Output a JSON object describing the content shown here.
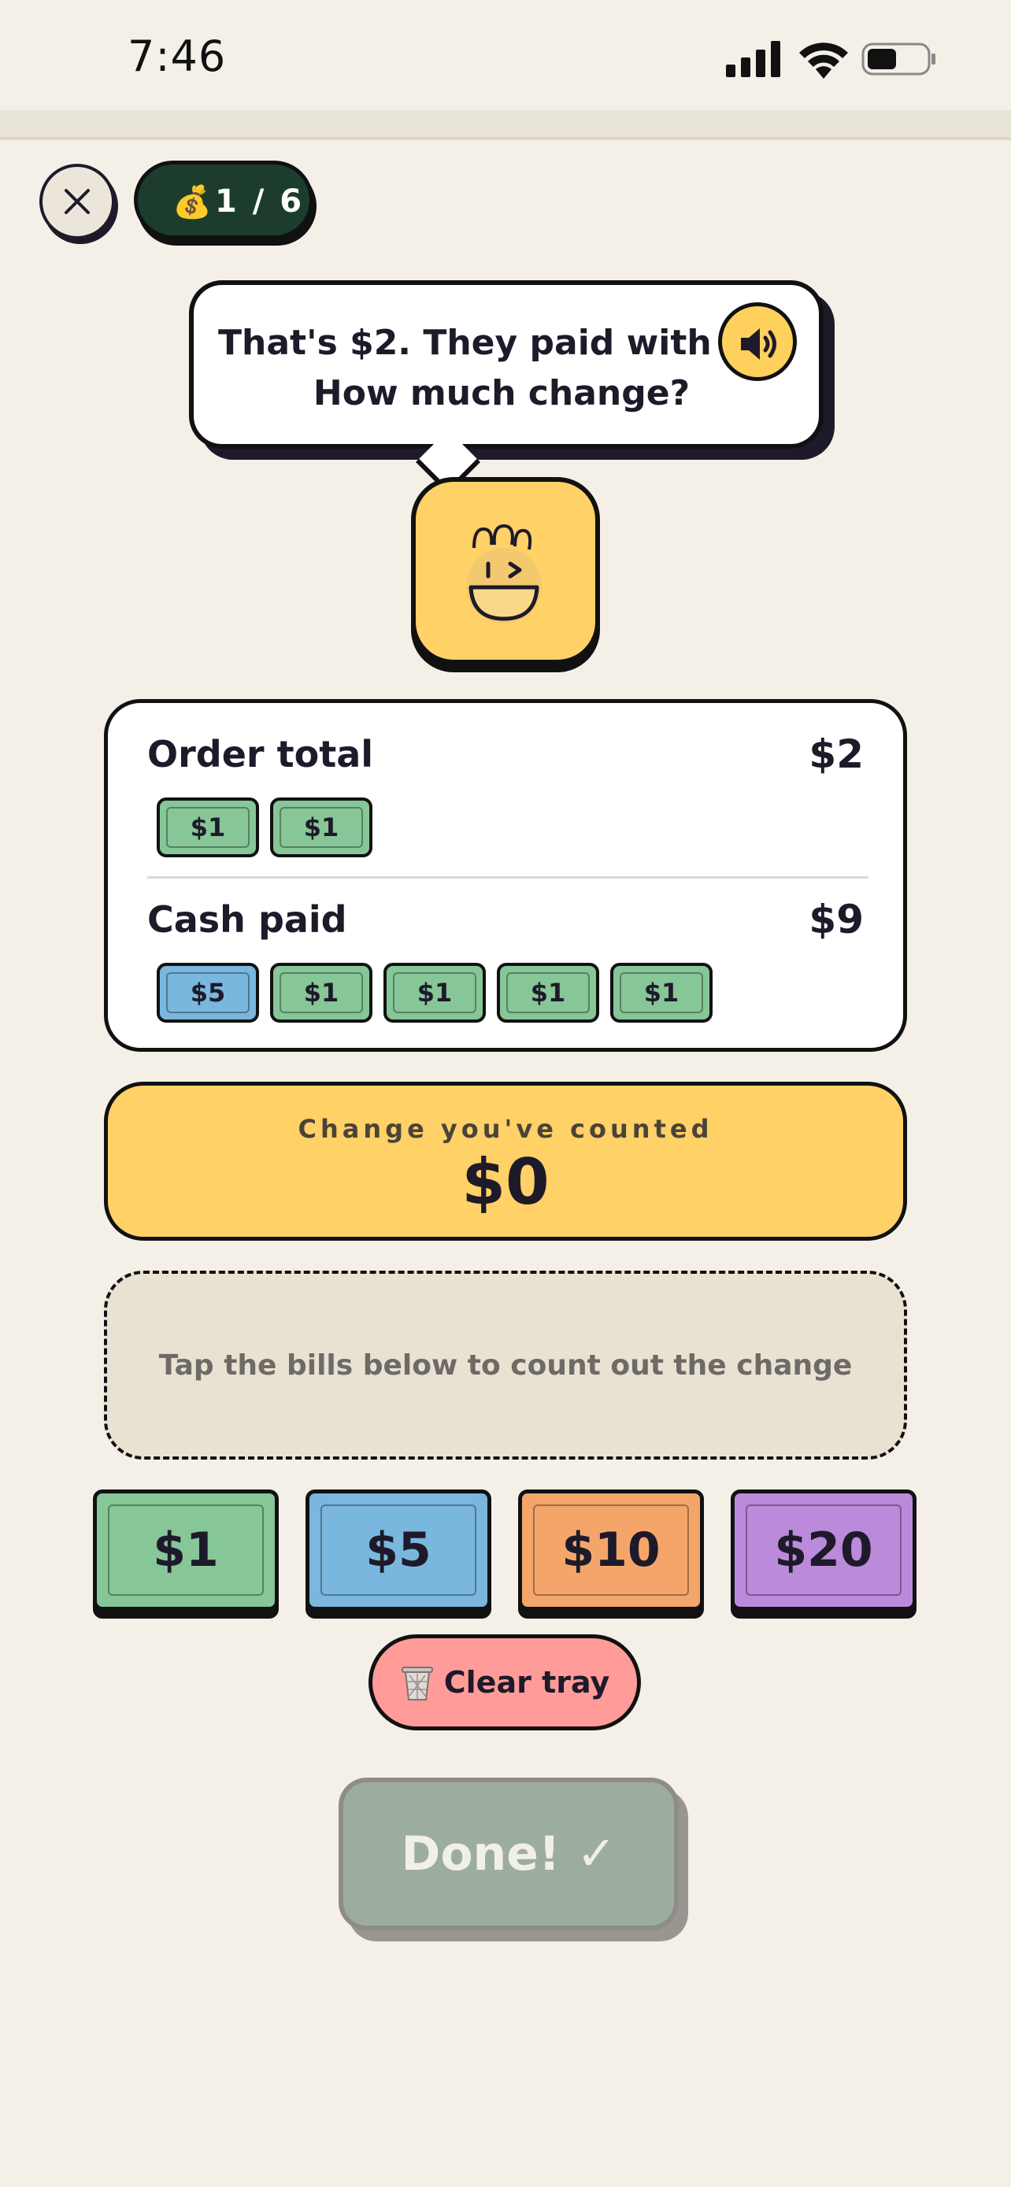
{
  "status_bar": {
    "time": "7:46"
  },
  "header": {
    "progress_icon": "money-bag-icon",
    "progress_emoji": "💰",
    "progress": "1 / 6"
  },
  "speech": {
    "line1": "That's $2. They paid with $9.",
    "line2": "How much change?",
    "speaker_icon": "speaker-icon"
  },
  "order": {
    "total_label": "Order total",
    "total_amount": "$2",
    "total_bills": [
      "$1",
      "$1"
    ],
    "paid_label": "Cash paid",
    "paid_amount": "$9",
    "paid_bills": [
      "$5",
      "$1",
      "$1",
      "$1",
      "$1"
    ]
  },
  "counter": {
    "label": "Change you've counted",
    "value": "$0"
  },
  "tray": {
    "hint": "Tap the bills below to count out the change"
  },
  "bills": [
    {
      "label": "$1",
      "color": "#86C697"
    },
    {
      "label": "$5",
      "color": "#7AB7DE"
    },
    {
      "label": "$10",
      "color": "#F4A66A"
    },
    {
      "label": "$20",
      "color": "#BC8ADA"
    }
  ],
  "clear_button": {
    "label": "Clear tray",
    "icon": "trash-can-icon"
  },
  "done_button": {
    "label": "Done! ✓"
  },
  "colors": {
    "background": "#F4F0E8",
    "accent_yellow": "#FFD166",
    "dark_green": "#1C3D2E",
    "bill_green": "#86C697",
    "bill_blue": "#7AB7DE",
    "bill_orange": "#F4A66A",
    "bill_purple": "#BC8ADA",
    "clear_pink": "#FF9C9A",
    "done_disabled": "#9CAD9E"
  }
}
